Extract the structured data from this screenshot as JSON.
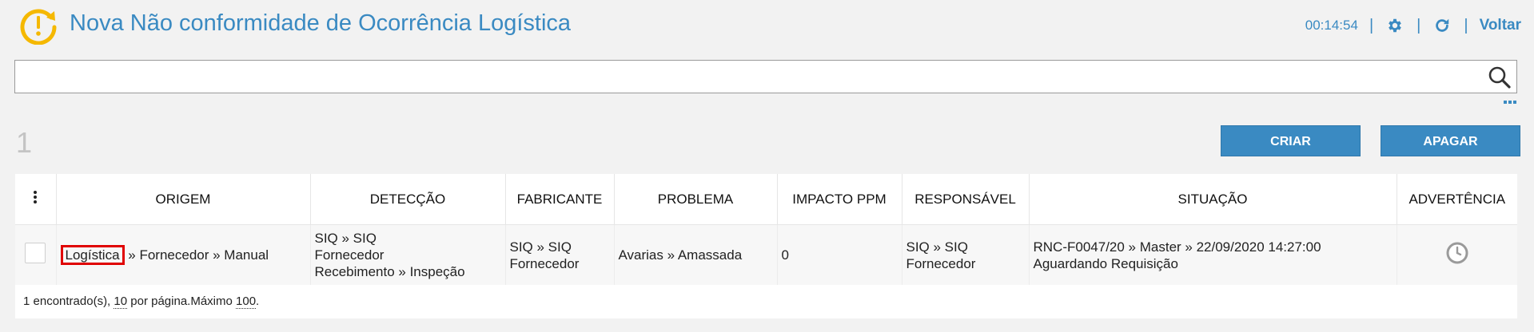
{
  "header": {
    "title": "Nova Não conformidade de Ocorrência Logística",
    "timer": "00:14:54",
    "back_label": "Voltar"
  },
  "search": {
    "value": "",
    "placeholder": ""
  },
  "record_count": "1",
  "actions": {
    "create_label": "CRIAR",
    "delete_label": "APAGAR"
  },
  "table": {
    "columns": [
      "ORIGEM",
      "DETECÇÃO",
      "FABRICANTE",
      "PROBLEMA",
      "IMPACTO PPM",
      "RESPONSÁVEL",
      "SITUAÇÃO",
      "ADVERTÊNCIA"
    ],
    "rows": [
      {
        "origem_highlight": "Logística",
        "origem_rest": "» Fornecedor » Manual",
        "deteccao_line1": "SIQ » SIQ",
        "deteccao_line2": "Fornecedor",
        "deteccao_line3": "Recebimento » Inspeção",
        "fabricante_line1": "SIQ » SIQ",
        "fabricante_line2": "Fornecedor",
        "problema": "Avarias » Amassada",
        "impacto_ppm": "0",
        "responsavel_line1": "SIQ » SIQ",
        "responsavel_line2": "Fornecedor",
        "situacao_line1": "RNC-F0047/20 » Master » 22/09/2020 14:27:00",
        "situacao_line2": "Aguardando Requisição",
        "advertencia_icon": "clock-icon"
      }
    ]
  },
  "footer": {
    "found": "1 encontrado(s),",
    "per_page_value": "10",
    "per_page_label": "por página.Máximo",
    "max_value": "100",
    "end": "."
  },
  "colors": {
    "accent": "#3a8ac2",
    "logo": "#f5b800",
    "highlight": "#e00000"
  }
}
